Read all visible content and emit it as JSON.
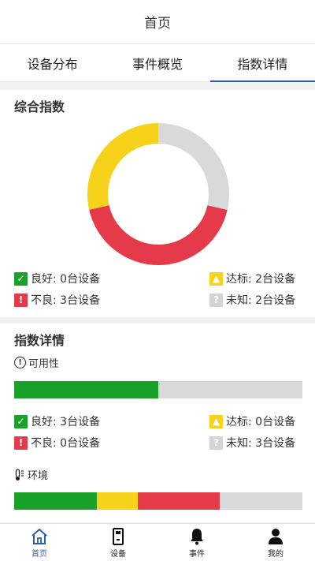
{
  "header": {
    "title": "首页"
  },
  "tabs": [
    {
      "label": "设备分布",
      "active": false
    },
    {
      "label": "事件概览",
      "active": false
    },
    {
      "label": "指数详情",
      "active": true
    }
  ],
  "composite": {
    "title": "综合指数",
    "chart_data": {
      "type": "pie",
      "categories": [
        "良好",
        "达标",
        "不良",
        "未知"
      ],
      "values": [
        0,
        2,
        3,
        2
      ],
      "colors": [
        "#1aa12a",
        "#f7d21a",
        "#e53a4a",
        "#d9d9d9"
      ]
    },
    "legend": {
      "good": "良好: 0台设备",
      "standard": "达标: 2台设备",
      "bad": "不良: 3台设备",
      "unknown": "未知: 2台设备"
    }
  },
  "details": {
    "title": "指数详情",
    "availability": {
      "label": "可用性",
      "bar": {
        "good": 3,
        "standard": 0,
        "bad": 0,
        "unknown": 3
      },
      "legend": {
        "good": "良好: 3台设备",
        "standard": "达标: 0台设备",
        "bad": "不良: 0台设备",
        "unknown": "未知: 3台设备"
      }
    },
    "environment": {
      "label": "环境",
      "bar": {
        "good": 2,
        "standard": 1,
        "bad": 2,
        "unknown": 2
      }
    }
  },
  "colors": {
    "good": "#1aa12a",
    "standard": "#f7d21a",
    "bad": "#e53a4a",
    "unknown": "#d9d9d9",
    "accent": "#2b5fa8"
  },
  "icons": {
    "good": "check-icon",
    "standard": "warning-triangle-icon",
    "bad": "exclamation-icon",
    "unknown": "question-icon"
  },
  "nav": [
    {
      "label": "首页",
      "icon": "home-icon",
      "active": true
    },
    {
      "label": "设备",
      "icon": "device-icon",
      "active": false
    },
    {
      "label": "事件",
      "icon": "bell-icon",
      "active": false
    },
    {
      "label": "我的",
      "icon": "user-icon",
      "active": false
    }
  ]
}
